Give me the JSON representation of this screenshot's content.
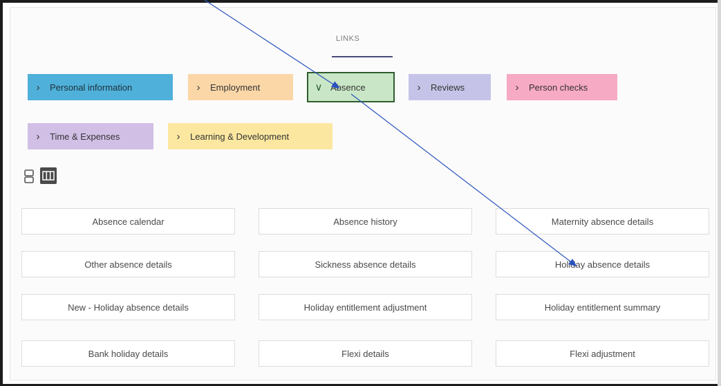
{
  "tabs": {
    "links": "LINKS"
  },
  "categories": [
    {
      "label": "Personal information",
      "chevron": "›"
    },
    {
      "label": "Employment",
      "chevron": "›"
    },
    {
      "label": "Absence",
      "chevron": "∨"
    },
    {
      "label": "Reviews",
      "chevron": "›"
    },
    {
      "label": "Person checks",
      "chevron": "›"
    },
    {
      "label": "Time & Expenses",
      "chevron": "›"
    },
    {
      "label": "Learning & Development",
      "chevron": "›"
    }
  ],
  "view_toggle": {
    "list": "list-view-icon",
    "grid": "grid-view-icon",
    "active": "grid"
  },
  "links": [
    "Absence calendar",
    "Absence history",
    "Maternity absence details",
    "Other absence details",
    "Sickness absence details",
    "Holiday absence details",
    "New - Holiday absence details",
    "Holiday entitlement adjustment",
    "Holiday entitlement summary",
    "Bank holiday details",
    "Flexi details",
    "Flexi adjustment"
  ],
  "colors": {
    "personal": "#4fb1d9",
    "employment": "#fbd7a8",
    "absence": "#c9e7c6",
    "reviews": "#c5c4e8",
    "person_checks": "#f7aac4",
    "time_expenses": "#d1bfe6",
    "learning": "#fbe7a0",
    "annotation_arrow": "#2a52be"
  }
}
